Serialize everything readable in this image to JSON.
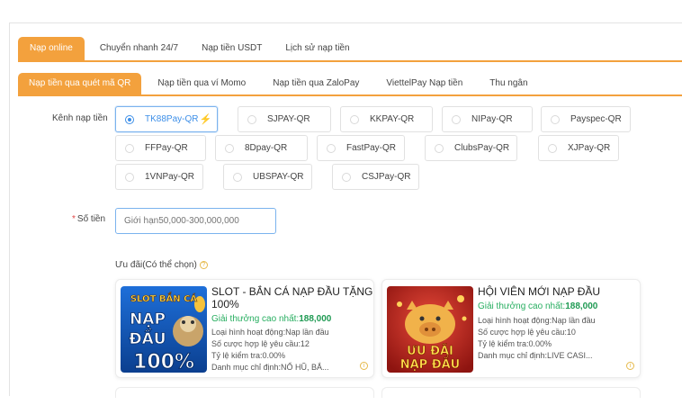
{
  "tabs_primary": [
    "Nạp online",
    "Chuyển nhanh 24/7",
    "Nạp tiền USDT",
    "Lịch sử nạp tiền"
  ],
  "tabs_secondary": [
    "Nạp tiền qua quét mã QR",
    "Nạp tiền qua ví Momo",
    "Nạp tiền qua ZaloPay",
    "ViettelPay Nạp tiền",
    "Thu ngân"
  ],
  "channel_label": "Kênh nạp tiền",
  "channels": {
    "c1": "TK88Pay-QR",
    "c2": "SJPAY-QR",
    "c3": "KKPAY-QR",
    "c4": "NIPay-QR",
    "c5": "Payspec-QR",
    "c6": "FFPay-QR",
    "c7": "8Dpay-QR",
    "c8": "FastPay-QR",
    "c9": "ClubsPay-QR",
    "c10": "XJPay-QR",
    "c11": "1VNPay-QR",
    "c12": "UBSPAY-QR",
    "c13": "CSJPay-QR"
  },
  "selected_channel": "TK88Pay-QR",
  "amount_label": "Số tiền",
  "amount_placeholder": "Giới hạn50,000-300,000,000",
  "offers_label": "Ưu đãi(Có thể chọn)",
  "offers": [
    {
      "title": "SLOT - BẮN CÁ NẠP ĐẦU TẶNG 100%",
      "bonus_label": "Giải thưởng cao nhất:",
      "bonus_value": "188,000",
      "line1": "Loại hình hoạt động:Nạp lần đầu",
      "line2": "Số cược hợp lệ yêu cầu:12",
      "line3": "Tỷ lệ kiểm tra:0.00%",
      "line4": "Danh mục chỉ định:NỔ HŨ, BẮ...",
      "img_text": [
        "SLOT BẮN CÁ",
        "NẠP",
        "ĐẦU",
        "100%"
      ]
    },
    {
      "title": "HỘI VIÊN MỚI NẠP ĐẦU",
      "bonus_label": "Giải thưởng cao nhất:",
      "bonus_value": "188,000",
      "line1": "Loại hình hoạt động:Nạp lần đầu",
      "line2": "Số cược hợp lệ yêu cầu:10",
      "line3": "Tỷ lệ kiểm tra:0.00%",
      "line4": "Danh mục chỉ định:LIVE CASI...",
      "img_text": [
        "ƯU ĐÃI",
        "NẠP ĐẦU"
      ]
    }
  ],
  "colors": {
    "accent": "#f3a13d",
    "selected": "#3d8fe8",
    "bonus": "#27ae60"
  },
  "icons": {
    "selected_badge": "lightning-icon",
    "info": "question-circle-icon"
  }
}
